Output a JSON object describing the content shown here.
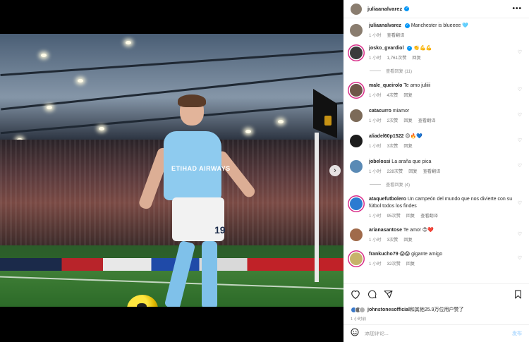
{
  "header": {
    "username": "juliaanalvarez",
    "more_label": "•••"
  },
  "caption": {
    "username": "juliaanalvarez",
    "text": "Manchester is blueeee 🩵",
    "time": "1 小时",
    "translate": "查看翻译"
  },
  "comments": [
    {
      "username": "josko_gvardiol",
      "text": "👏💪💪",
      "time": "1 小时",
      "likes": "1,761次赞",
      "reply": "回复",
      "translate": "",
      "view_replies": "查看回复 (11)"
    },
    {
      "username": "male_queirolo",
      "text": "Te amo juliiii",
      "time": "1 小时",
      "likes": "4次赞",
      "reply": "回复",
      "translate": "",
      "view_replies": ""
    },
    {
      "username": "catacurro",
      "text": "miamor",
      "time": "1 小时",
      "likes": "2次赞",
      "reply": "回复",
      "translate": "查看翻译",
      "view_replies": ""
    },
    {
      "username": "aliadel60p1522",
      "text": "😍🔥💙",
      "time": "1 小时",
      "likes": "3次赞",
      "reply": "回复",
      "translate": "",
      "view_replies": ""
    },
    {
      "username": "jobelossi",
      "text": "La araña que pica",
      "time": "1 小时",
      "likes": "228次赞",
      "reply": "回复",
      "translate": "查看翻译",
      "view_replies": "查看回复 (4)"
    },
    {
      "username": "ataquefutbolero",
      "text": "Un campeón del mundo que nos divierte con su fútbol todos los findes",
      "time": "1 小时",
      "likes": "95次赞",
      "reply": "回复",
      "translate": "查看翻译",
      "view_replies": ""
    },
    {
      "username": "arianasantose",
      "text": "Te amo! 😍❤️",
      "time": "1 小时",
      "likes": "3次赞",
      "reply": "回复",
      "translate": "",
      "view_replies": ""
    },
    {
      "username": "frankucho79",
      "text": "😱😱 gigante amigo",
      "time": "1 小时",
      "likes": "32次赞",
      "reply": "回复",
      "translate": "",
      "view_replies": ""
    }
  ],
  "likes_summary": {
    "user": "johnstonesofficial",
    "text": "和其他25.9万位用户赞了"
  },
  "post_time": "1 小时前",
  "add_comment": {
    "placeholder": "添加评论...",
    "post_label": "发布"
  },
  "photo": {
    "shirt_sponsor": "ETIHAD AIRWAYS",
    "shorts_number": "19",
    "next_icon": "›"
  },
  "colors": {
    "link_blue": "#0095f6",
    "story_ring": "#d8308a",
    "muted": "#8e8e8e"
  }
}
